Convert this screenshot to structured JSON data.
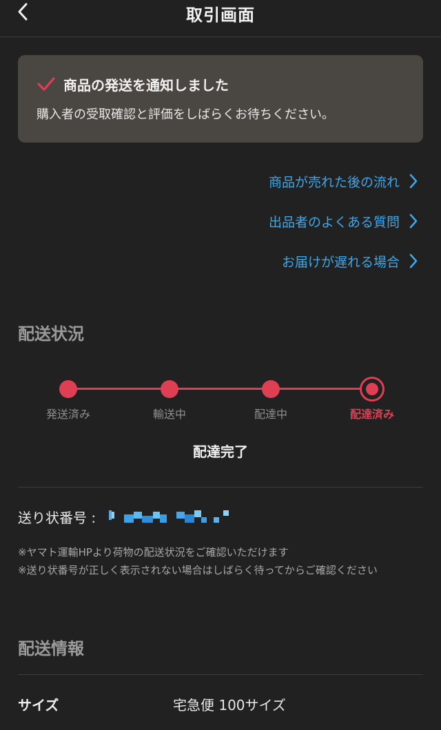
{
  "header": {
    "title": "取引画面",
    "back_icon": "chevron-left-icon"
  },
  "notice": {
    "icon": "check-icon",
    "title": "商品の発送を通知しました",
    "body": "購入者の受取確認と評価をしばらくお待ちください。"
  },
  "help_links": [
    {
      "label": "商品が売れた後の流れ"
    },
    {
      "label": "出品者のよくある質問"
    },
    {
      "label": "お届けが遅れる場合"
    }
  ],
  "shipping_status": {
    "title": "配送状況",
    "steps": [
      {
        "label": "発送済み"
      },
      {
        "label": "輸送中"
      },
      {
        "label": "配達中"
      },
      {
        "label": "配達済み"
      }
    ],
    "current_step": 4,
    "status_text": "配達完了"
  },
  "tracking": {
    "label": "送り状番号 :",
    "notes": [
      "※ヤマト運輸HPより荷物の配送状況をご確認いただけます",
      "※送り状番号が正しく表示されない場合はしばらく待ってからご確認ください"
    ]
  },
  "shipping_info": {
    "title": "配送情報",
    "rows": [
      {
        "label": "サイズ",
        "value": "宅急便 100サイズ"
      }
    ]
  },
  "colors": {
    "accent": "#de3f52",
    "link": "#3ea7ea",
    "background": "#212121",
    "notice_bg": "#4a4641"
  }
}
